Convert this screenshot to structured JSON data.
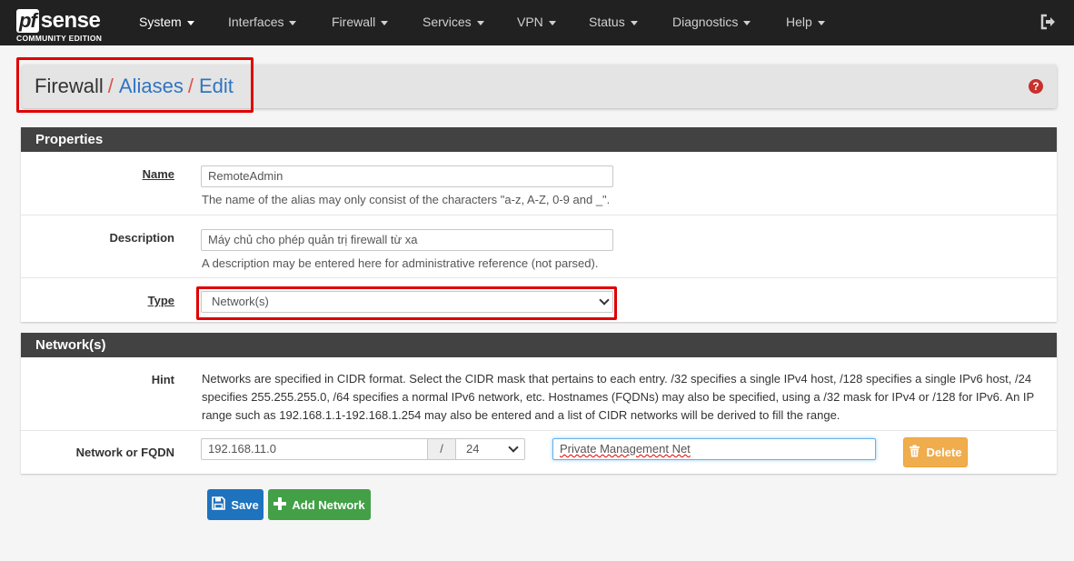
{
  "navbar": {
    "logo_pf": "pf",
    "logo_sense": "sense",
    "logo_sub": "COMMUNITY EDITION",
    "items": [
      {
        "label": "System"
      },
      {
        "label": "Interfaces"
      },
      {
        "label": "Firewall"
      },
      {
        "label": "Services"
      },
      {
        "label": "VPN"
      },
      {
        "label": "Status"
      },
      {
        "label": "Diagnostics"
      },
      {
        "label": "Help"
      }
    ],
    "logout_icon": "sign-out-icon"
  },
  "breadcrumb": {
    "items": [
      "Firewall",
      "Aliases",
      "Edit"
    ],
    "separator": "/",
    "help_icon": "question-circle-icon",
    "help_glyph": "?"
  },
  "properties": {
    "title": "Properties",
    "name": {
      "label": "Name",
      "value": "RemoteAdmin",
      "help": "The name of the alias may only consist of the characters \"a-z, A-Z, 0-9 and _\"."
    },
    "description": {
      "label": "Description",
      "value": "Máy chủ cho phép  quản trị firewall từ xa",
      "help": "A description may be entered here for administrative reference (not parsed)."
    },
    "type": {
      "label": "Type",
      "value": "Network(s)"
    }
  },
  "networks": {
    "title": "Network(s)",
    "hint": {
      "label": "Hint",
      "text": "Networks are specified in CIDR format. Select the CIDR mask that pertains to each entry. /32 specifies a single IPv4 host, /128 specifies a single IPv6 host, /24 specifies 255.255.255.0, /64 specifies a normal IPv6 network, etc. Hostnames (FQDNs) may also be specified, using a /32 mask for IPv4 or /128 for IPv6. An IP range such as 192.168.1.1-192.168.1.254 may also be entered and a list of CIDR networks will be derived to fill the range."
    },
    "entry": {
      "label": "Network or FQDN",
      "address": "192.168.11.0",
      "slash": "/",
      "mask": "24",
      "description": "Private Management Net",
      "delete_label": "Delete"
    }
  },
  "actions": {
    "save_label": "Save",
    "add_label": "Add Network"
  },
  "colors": {
    "navbar_bg": "#212121",
    "panel_head": "#424242",
    "link": "#3174c1",
    "highlight": "#e00000",
    "save": "#1e73be",
    "add": "#43a047",
    "delete": "#f0ad4e"
  }
}
